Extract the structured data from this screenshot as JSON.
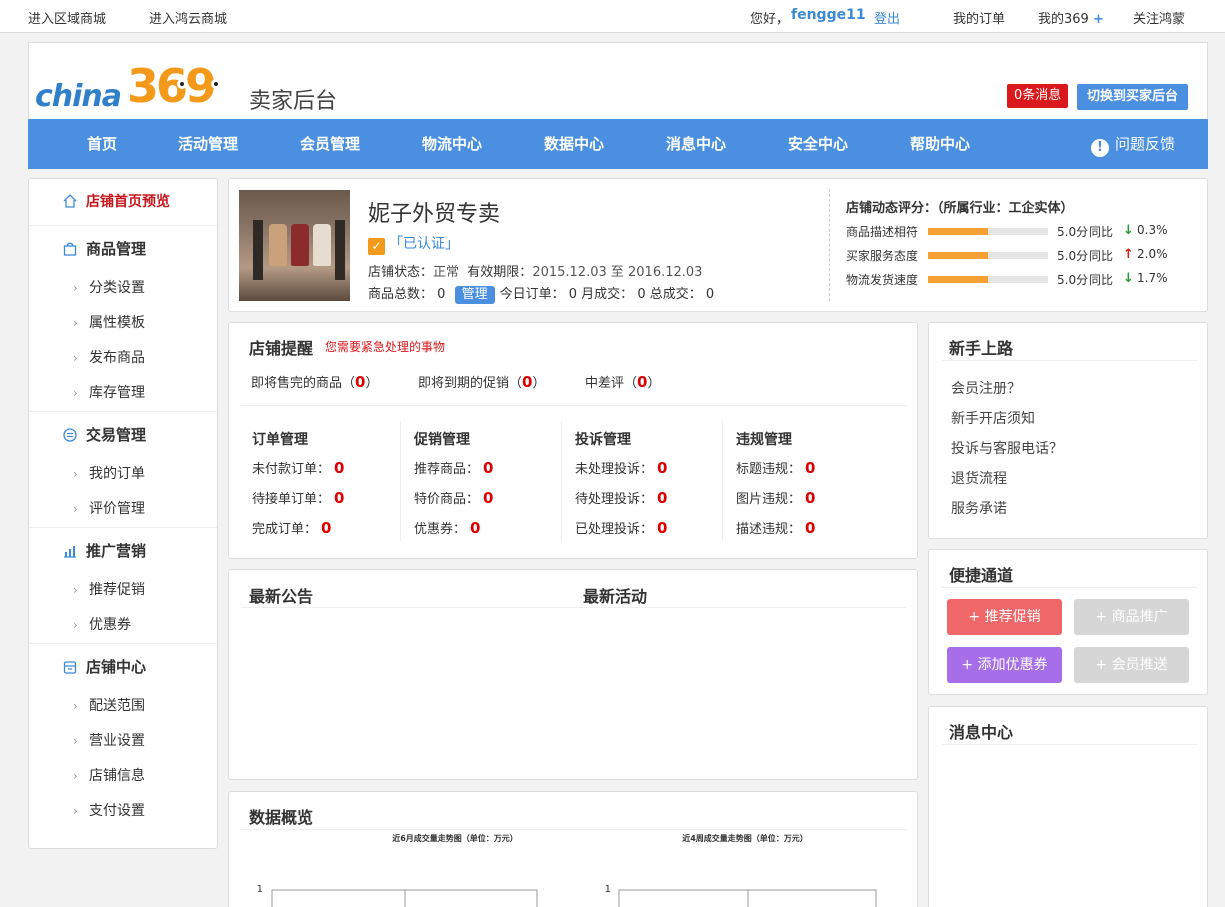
{
  "topbar": {
    "region_mall": "进入区域商城",
    "hongyun_mall": "进入鸿云商城",
    "greeting": "您好，",
    "username": "fengge11",
    "logout": "登出",
    "my_orders": "我的订单",
    "my369": "我的369",
    "my369_plus": "+",
    "follow": "关注鸿蒙"
  },
  "header": {
    "logo_word": "china",
    "logo_num": "369",
    "title": "卖家后台",
    "msg_count": "0",
    "msg_suffix": "条消息",
    "switch_label": "切换到买家后台"
  },
  "nav": {
    "items": [
      "首页",
      "活动管理",
      "会员管理",
      "物流中心",
      "数据中心",
      "消息中心",
      "安全中心",
      "帮助中心"
    ],
    "feedback_icon": "!",
    "feedback": "问题反馈"
  },
  "sidebar": {
    "preview": "店铺首页预览",
    "sections": [
      {
        "title": "商品管理",
        "icon": "bag-icon",
        "items": [
          "分类设置",
          "属性模板",
          "发布商品",
          "库存管理"
        ]
      },
      {
        "title": "交易管理",
        "icon": "exchange-icon",
        "items": [
          "我的订单",
          "评价管理"
        ]
      },
      {
        "title": "推广营销",
        "icon": "chart-icon",
        "items": [
          "推荐促销",
          "优惠券"
        ]
      },
      {
        "title": "店铺中心",
        "icon": "store-icon",
        "items": [
          "配送范围",
          "营业设置",
          "店铺信息",
          "支付设置"
        ]
      }
    ]
  },
  "store": {
    "name": "妮子外贸专卖",
    "check": "✓",
    "verified": "「已认证」",
    "status_label": "店铺状态：",
    "status_value": "正常",
    "valid_label": "有效期限：",
    "valid_value": "2015.12.03 至 2016.12.03",
    "total_label": "商品总数：",
    "total_value": "0",
    "manage": "管理",
    "today_label": "今日订单：",
    "today_value": "0",
    "month_label": "月成交：",
    "month_value": "0",
    "all_label": "总成交：",
    "all_value": "0"
  },
  "rating": {
    "title": "店铺动态评分：（所属行业：工企实体）",
    "compare": "同比",
    "rows": [
      {
        "label": "商品描述相符",
        "score": "5.0分",
        "level": 0.5,
        "dir": "down",
        "arrow": "↓",
        "arrow_color": "#2a9a3a",
        "pct": "0.3%"
      },
      {
        "label": "买家服务态度",
        "score": "5.0分",
        "level": 0.5,
        "dir": "up",
        "arrow": "↑",
        "arrow_color": "#d9191c",
        "pct": "2.0%"
      },
      {
        "label": "物流发货速度",
        "score": "5.0分",
        "level": 0.5,
        "dir": "down",
        "arrow": "↓",
        "arrow_color": "#2a9a3a",
        "pct": "1.7%"
      }
    ]
  },
  "reminder": {
    "title": "店铺提醒",
    "subtitle": "您需要紧急处理的事物",
    "alerts": [
      {
        "label": "即将售完的商品",
        "open": "（",
        "value": "0",
        "close": "）"
      },
      {
        "label": "即将到期的促销",
        "open": "（",
        "value": "0",
        "close": "）"
      },
      {
        "label": "中差评",
        "open": "（",
        "value": "0",
        "close": "）"
      }
    ],
    "columns": [
      {
        "title": "订单管理",
        "rows": [
          {
            "label": "未付款订单：",
            "value": "0"
          },
          {
            "label": "待接单订单：",
            "value": "0"
          },
          {
            "label": "完成订单：",
            "value": "0"
          }
        ]
      },
      {
        "title": "促销管理",
        "rows": [
          {
            "label": "推荐商品：",
            "value": "0"
          },
          {
            "label": "特价商品：",
            "value": "0"
          },
          {
            "label": "优惠券：",
            "value": "0"
          }
        ]
      },
      {
        "title": "投诉管理",
        "rows": [
          {
            "label": "未处理投诉：",
            "value": "0"
          },
          {
            "label": "待处理投诉：",
            "value": "0"
          },
          {
            "label": "已处理投诉：",
            "value": "0"
          }
        ]
      },
      {
        "title": "违规管理",
        "rows": [
          {
            "label": "标题违规：",
            "value": "0"
          },
          {
            "label": "图片违规：",
            "value": "0"
          },
          {
            "label": "描述违规：",
            "value": "0"
          }
        ]
      }
    ]
  },
  "news": {
    "announce": "最新公告",
    "activity": "最新活动"
  },
  "overview": {
    "title": "数据概览",
    "chart1_title": "近6月成交量走势图（单位：万元）",
    "chart2_title": "近4周成交量走势图（单位：万元）",
    "tick": "1"
  },
  "chart_data": [
    {
      "type": "line",
      "title": "近6月成交量走势图（单位：万元）",
      "ytick": "1",
      "series": []
    },
    {
      "type": "line",
      "title": "近4周成交量走势图（单位：万元）",
      "ytick": "1",
      "series": []
    }
  ],
  "newbie": {
    "title": "新手上路",
    "links": [
      "会员注册？",
      "新手开店须知",
      "投诉与客服电话？",
      "退货流程",
      "服务承诺"
    ]
  },
  "quick": {
    "title": "便捷通道",
    "buttons": [
      {
        "label": "+ 推荐促销",
        "color": "#f0676a"
      },
      {
        "label": "+ 商品推广",
        "color": "#d6d6d6"
      },
      {
        "label": "+ 添加优惠券",
        "color": "#a66ee8"
      },
      {
        "label": "+ 会员推送",
        "color": "#d6d6d6"
      }
    ]
  },
  "msgcenter": {
    "title": "消息中心"
  },
  "colors": {
    "brand": "#4a8fe0",
    "alert": "#d9191c",
    "rating_bar": "#f5a033"
  }
}
